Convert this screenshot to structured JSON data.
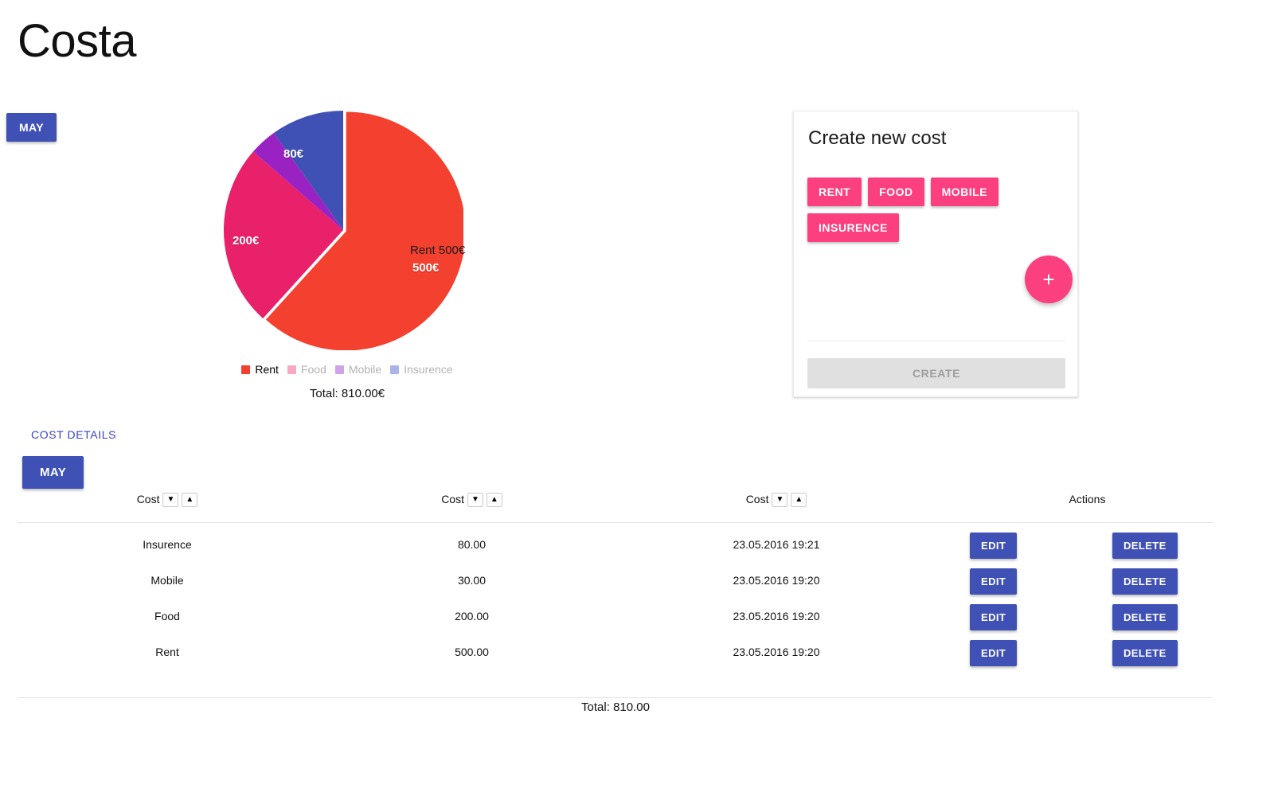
{
  "app": {
    "title": "Costa"
  },
  "top_month_button": {
    "label": "MAY"
  },
  "chart_section": {
    "total_label": "Total: 810.00€",
    "tooltip": "Rent 500€"
  },
  "chart_data": {
    "type": "pie",
    "title": "",
    "categories": [
      "Rent",
      "Food",
      "Mobile",
      "Insurence"
    ],
    "values": [
      500,
      200,
      30,
      80
    ],
    "unit": "€",
    "total": 810.0,
    "slice_labels": [
      "500€",
      "200€",
      "",
      "80€"
    ],
    "colors": [
      "#f4402e",
      "#e9206a",
      "#9b22c2",
      "#3f51b5"
    ],
    "legend": [
      {
        "label": "Rent",
        "color": "#f4402e",
        "active": true
      },
      {
        "label": "Food",
        "color": "#f7a8c4",
        "active": false
      },
      {
        "label": "Mobile",
        "color": "#d0a3e8",
        "active": false
      },
      {
        "label": "Insurence",
        "color": "#a8b4e8",
        "active": false
      }
    ],
    "legend_position": "bottom",
    "hovered_slice": "Rent",
    "hover_label": "Rent 500€"
  },
  "create_card": {
    "title": "Create new cost",
    "chips": [
      "RENT",
      "FOOD",
      "MOBILE",
      "INSURENCE"
    ],
    "add_icon": "plus-icon",
    "add_symbol": "+",
    "create_label": "CREATE",
    "create_disabled": true,
    "accent_color": "#fb3f7f"
  },
  "details": {
    "link_label": "COST DETAILS",
    "month_button": "MAY",
    "columns": [
      "Cost",
      "Cost",
      "Cost",
      "Actions"
    ],
    "sort_desc_icon": "▼",
    "sort_asc_icon": "▲",
    "rows": [
      {
        "name": "Insurence",
        "amount": "80.00",
        "date": "23.05.2016 19:21",
        "edit": "EDIT",
        "delete": "DELETE"
      },
      {
        "name": "Mobile",
        "amount": "30.00",
        "date": "23.05.2016 19:20",
        "edit": "EDIT",
        "delete": "DELETE"
      },
      {
        "name": "Food",
        "amount": "200.00",
        "date": "23.05.2016 19:20",
        "edit": "EDIT",
        "delete": "DELETE"
      },
      {
        "name": "Rent",
        "amount": "500.00",
        "date": "23.05.2016 19:20",
        "edit": "EDIT",
        "delete": "DELETE"
      }
    ],
    "total_label": "Total: 810.00"
  }
}
